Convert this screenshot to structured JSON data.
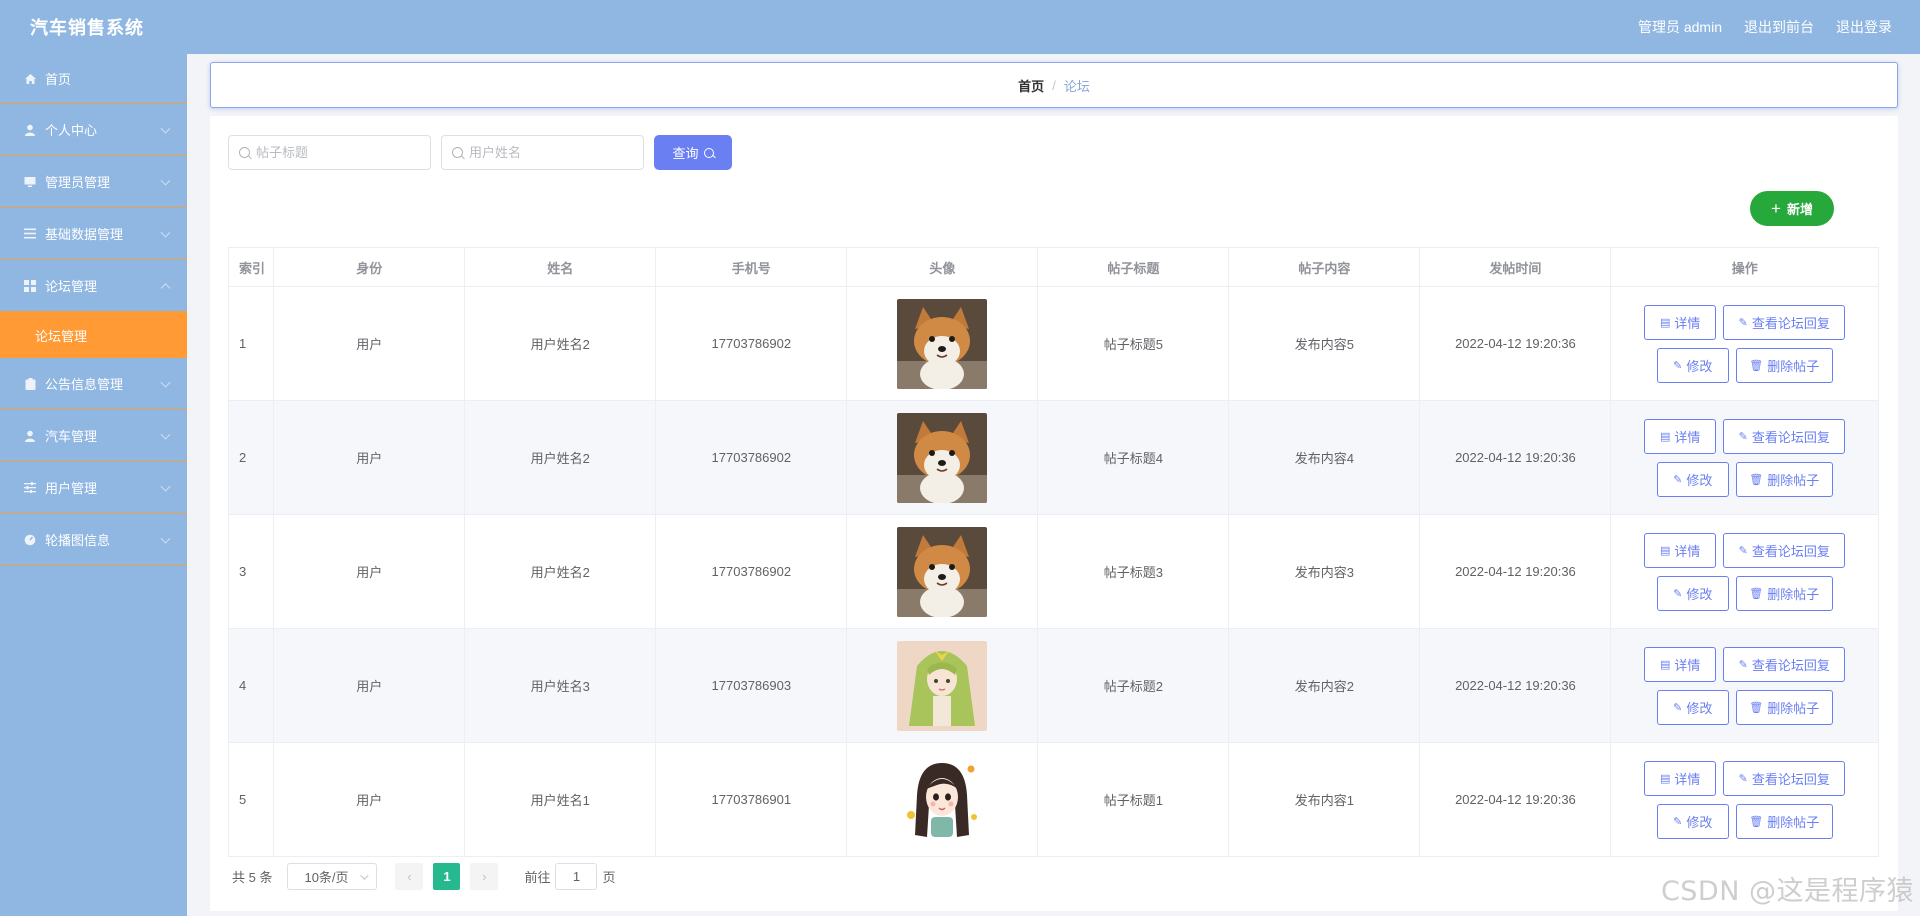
{
  "app": {
    "title": "汽车销售系统",
    "user": "管理员 admin",
    "to_front": "退出到前台",
    "logout": "退出登录"
  },
  "sidebar": {
    "items": [
      {
        "label": "首页",
        "icon": "home-icon"
      },
      {
        "label": "个人中心",
        "icon": "user-icon"
      },
      {
        "label": "管理员管理",
        "icon": "monitor-icon"
      },
      {
        "label": "基础数据管理",
        "icon": "list-icon"
      },
      {
        "label": "论坛管理",
        "icon": "grid-icon"
      },
      {
        "label": "公告信息管理",
        "icon": "clipboard-icon"
      },
      {
        "label": "汽车管理",
        "icon": "user-icon"
      },
      {
        "label": "用户管理",
        "icon": "sliders-icon"
      },
      {
        "label": "轮播图信息",
        "icon": "gauge-icon"
      }
    ],
    "active_sub": "论坛管理"
  },
  "breadcrumb": {
    "home": "首页",
    "current": "论坛"
  },
  "search": {
    "title_placeholder": "帖子标题",
    "name_placeholder": "用户姓名",
    "query_label": "查询"
  },
  "add_label": "新增",
  "table": {
    "headers": [
      "索引",
      "身份",
      "姓名",
      "手机号",
      "头像",
      "帖子标题",
      "帖子内容",
      "发帖时间",
      "操作"
    ],
    "rows": [
      {
        "index": "1",
        "role": "用户",
        "name": "用户姓名2",
        "phone": "17703786902",
        "avatar": "shiba-dog-photo",
        "title": "帖子标题5",
        "content": "发布内容5",
        "time": "2022-04-12 19:20:36"
      },
      {
        "index": "2",
        "role": "用户",
        "name": "用户姓名2",
        "phone": "17703786902",
        "avatar": "shiba-dog-photo",
        "title": "帖子标题4",
        "content": "发布内容4",
        "time": "2022-04-12 19:20:36"
      },
      {
        "index": "3",
        "role": "用户",
        "name": "用户姓名2",
        "phone": "17703786902",
        "avatar": "shiba-dog-photo",
        "title": "帖子标题3",
        "content": "发布内容3",
        "time": "2022-04-12 19:20:36"
      },
      {
        "index": "4",
        "role": "用户",
        "name": "用户姓名3",
        "phone": "17703786903",
        "avatar": "anime-girl-green-hair",
        "title": "帖子标题2",
        "content": "发布内容2",
        "time": "2022-04-12 19:20:36"
      },
      {
        "index": "5",
        "role": "用户",
        "name": "用户姓名1",
        "phone": "17703786901",
        "avatar": "cartoon-girl",
        "title": "帖子标题1",
        "content": "发布内容1",
        "time": "2022-04-12 19:20:36"
      }
    ],
    "actions": {
      "detail": "详情",
      "reply": "查看论坛回复",
      "edit": "修改",
      "delete": "删除帖子"
    }
  },
  "pagination": {
    "total": "共 5 条",
    "page_size": "10条/页",
    "current_page": "1",
    "goto_prefix": "前往",
    "goto_value": "1",
    "goto_suffix": "页"
  },
  "watermark": "CSDN @这是程序猿",
  "colors": {
    "topbar": "#90b6e2",
    "sidebar": "#90b6e2",
    "active_sub": "#ff9a35",
    "primary": "#6a7ff2",
    "add_button": "#27a83b",
    "page_active": "#26b98f"
  }
}
